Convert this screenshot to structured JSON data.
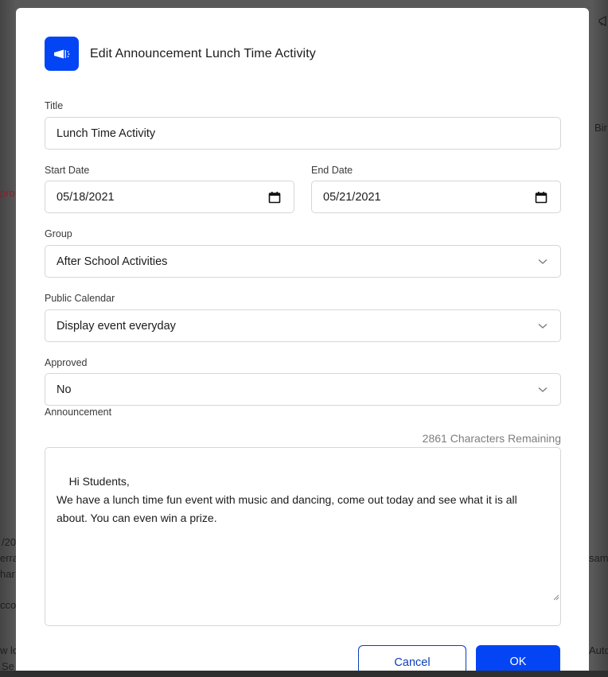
{
  "background": {
    "fragments": {
      "top_right_icon": "megaphone-icon",
      "right_1": "Bir",
      "left_red": "pro",
      "left_1": "/20",
      "left_2": "erra",
      "left_3": "har",
      "left_4": "cco",
      "left_5": "w lo",
      "left_6": "Se",
      "right_2": "sam",
      "right_3": "Auto"
    }
  },
  "dialog": {
    "icon": "megaphone-icon",
    "title": "Edit Announcement Lunch Time Activity",
    "accent_color": "#0345f5",
    "fields": {
      "title": {
        "label": "Title",
        "value": "Lunch Time Activity"
      },
      "start_date": {
        "label": "Start Date",
        "value": "05/18/2021",
        "icon": "calendar-icon"
      },
      "end_date": {
        "label": "End Date",
        "value": "05/21/2021",
        "icon": "calendar-icon"
      },
      "group": {
        "label": "Group",
        "value": "After School Activities",
        "icon": "chevron-down-icon"
      },
      "public_calendar": {
        "label": "Public Calendar",
        "value": "Display event everyday",
        "icon": "chevron-down-icon"
      },
      "approved": {
        "label": "Approved",
        "value": "No",
        "icon": "chevron-down-icon"
      },
      "announcement": {
        "label": "Announcement",
        "counter": "2861 Characters Remaining",
        "value": "Hi Students,\nWe have a lunch time fun event with music and dancing, come out today and see what it is all about. You can even win a prize."
      }
    },
    "buttons": {
      "cancel": "Cancel",
      "ok": "OK"
    }
  }
}
